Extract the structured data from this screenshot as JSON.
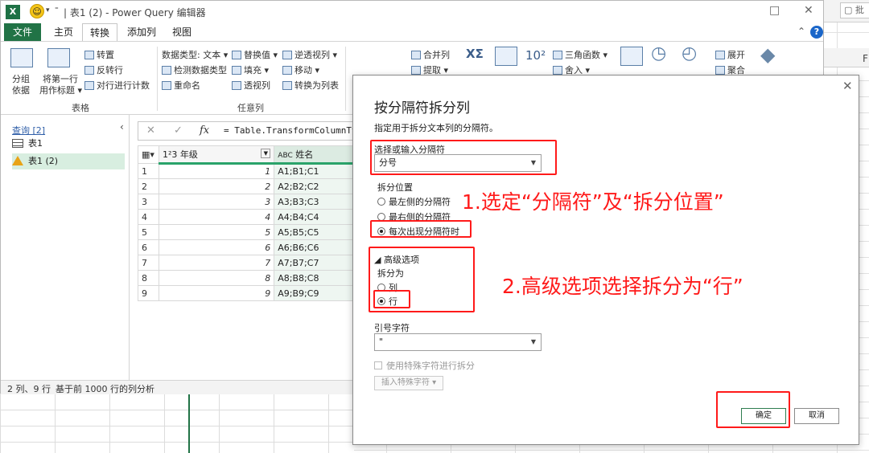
{
  "window": {
    "title": "| 表1 (2) - Power Query 编辑器",
    "app_icon": "X",
    "minimize": "□",
    "close": "✕"
  },
  "excel": {
    "toolbar_button": "批",
    "column_label": "F"
  },
  "menu": {
    "file": "文件",
    "tabs": [
      "主页",
      "转换",
      "添加列",
      "视图"
    ],
    "active_tab": "转换"
  },
  "ribbon": {
    "group_table": {
      "label": "表格",
      "group_by": [
        "分组",
        "依据"
      ],
      "first_row": [
        "将第一行",
        "用作标题 ▾"
      ],
      "transpose": "转置",
      "reverse_rows": "反转行",
      "count_rows": "对行进行计数"
    },
    "group_any_column": {
      "label": "任意列",
      "data_type": "数据类型: 文本 ▾",
      "detect_type": "检测数据类型",
      "rename": "重命名",
      "replace_values": "替换值 ▾",
      "fill": "填充 ▾",
      "pivot": "透视列",
      "unpivot": "逆透视列 ▾",
      "move": "移动 ▾",
      "convert_to_list": "转换为列表"
    },
    "text_column": {
      "merge_columns": "合并列",
      "extract": "提取 ▾"
    },
    "number_column": {
      "trig": "三角函数 ▾",
      "rounding": "舍入 ▾",
      "power": "10²"
    },
    "structured": {
      "expand": "展开",
      "aggregate": "聚合"
    }
  },
  "queries": {
    "title": "查询 [2]",
    "items": [
      "表1",
      "表1 (2)"
    ],
    "selected": "表1 (2)"
  },
  "formula_bar": {
    "cancel": "✕",
    "confirm": "✓",
    "fx": "fx",
    "formula": "= Table.TransformColumnTypes"
  },
  "grid": {
    "headers": [
      {
        "type": "1²3",
        "name": "年级"
      },
      {
        "type": "ABC",
        "name": "姓名"
      }
    ],
    "rows": [
      {
        "n": "1",
        "grade": "1",
        "name": "A1;B1;C1"
      },
      {
        "n": "2",
        "grade": "2",
        "name": "A2;B2;C2"
      },
      {
        "n": "3",
        "grade": "3",
        "name": "A3;B3;C3"
      },
      {
        "n": "4",
        "grade": "4",
        "name": "A4;B4;C4"
      },
      {
        "n": "5",
        "grade": "5",
        "name": "A5;B5;C5"
      },
      {
        "n": "6",
        "grade": "6",
        "name": "A6;B6;C6"
      },
      {
        "n": "7",
        "grade": "7",
        "name": "A7;B7;C7"
      },
      {
        "n": "8",
        "grade": "8",
        "name": "A8;B8;C8"
      },
      {
        "n": "9",
        "grade": "9",
        "name": "A9;B9;C9"
      }
    ]
  },
  "status": {
    "counts": "2 列、9 行",
    "profile": "基于前 1000 行的列分析"
  },
  "dialog": {
    "title": "按分隔符拆分列",
    "subtitle": "指定用于拆分文本列的分隔符。",
    "delimiter_label": "选择或输入分隔符",
    "delimiter_value": "分号",
    "split_at_label": "拆分位置",
    "split_at_options": [
      "最左侧的分隔符",
      "最右侧的分隔符",
      "每次出现分隔符时"
    ],
    "split_at_selected": 2,
    "advanced_label": "◢ 高级选项",
    "split_into_label": "拆分为",
    "split_into_options": [
      "列",
      "行"
    ],
    "split_into_selected": 1,
    "quote_label": "引号字符",
    "quote_value": "\"",
    "special_chars_label": "使用特殊字符进行拆分",
    "insert_special_label": "插入特殊字符 ▾",
    "ok": "确定",
    "cancel": "取消",
    "close": "✕"
  },
  "annotations": {
    "step1": "1.选定“分隔符”及“拆分位置”",
    "step2": "2.高级选项选择拆分为“行”",
    "color": "#ff1a1a"
  },
  "colors": {
    "excel_green": "#217346",
    "column_accent": "#2aa36a",
    "help_blue": "#1a66c9"
  }
}
